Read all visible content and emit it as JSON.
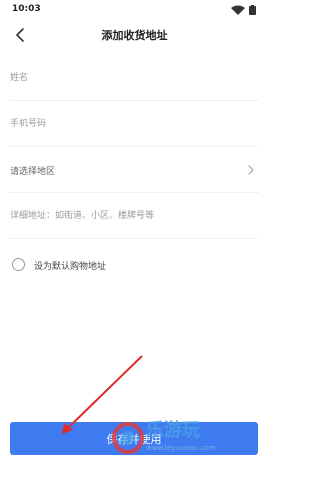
{
  "status_bar": {
    "time": "10:03",
    "icons": [
      "wifi-icon",
      "battery-icon"
    ]
  },
  "nav": {
    "back_icon": "chevron-left-icon",
    "title": "添加收货地址"
  },
  "form": {
    "name_placeholder": "姓名",
    "phone_placeholder": "手机号码",
    "region_label": "请选择地区",
    "detail_placeholder": "详细地址：如街道、小区、楼牌号等",
    "default_label": "设为默认购物地址",
    "default_checked": false
  },
  "save_button": {
    "label": "保存并使用"
  },
  "watermark": {
    "title": "乐游玩",
    "url": "www.leyouwan.com"
  },
  "colors": {
    "accent": "#3f7bf0",
    "annotation_arrow": "#e02a2a"
  }
}
